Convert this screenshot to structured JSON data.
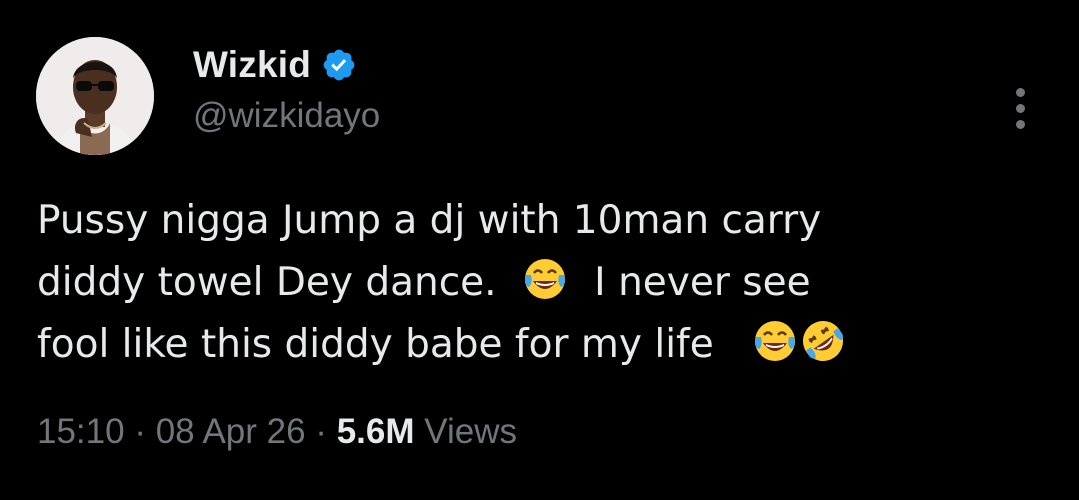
{
  "author": {
    "display_name": "Wizkid",
    "handle": "@wizkidayo",
    "verified_icon": "verified-badge-icon",
    "avatar": "profile-photo"
  },
  "more_icon": "more-options-icon",
  "tweet": {
    "line1": "Pussy nigga Jump a dj with 10man carry",
    "line2_a": "diddy towel Dey dance.",
    "line2_emoji": "😂",
    "line2_b": "I never see",
    "line3_a": "fool like this diddy babe for my life",
    "line3_emoji1": "😂",
    "line3_emoji2": "🤣"
  },
  "meta": {
    "time": "15:10",
    "separator": "·",
    "date": "08 Apr 26",
    "views_count": "5.6M",
    "views_label": "Views"
  },
  "colors": {
    "background": "#000000",
    "primary_text": "#e7e9ea",
    "secondary_text": "#71767b",
    "verified_blue": "#1d9bf0"
  }
}
